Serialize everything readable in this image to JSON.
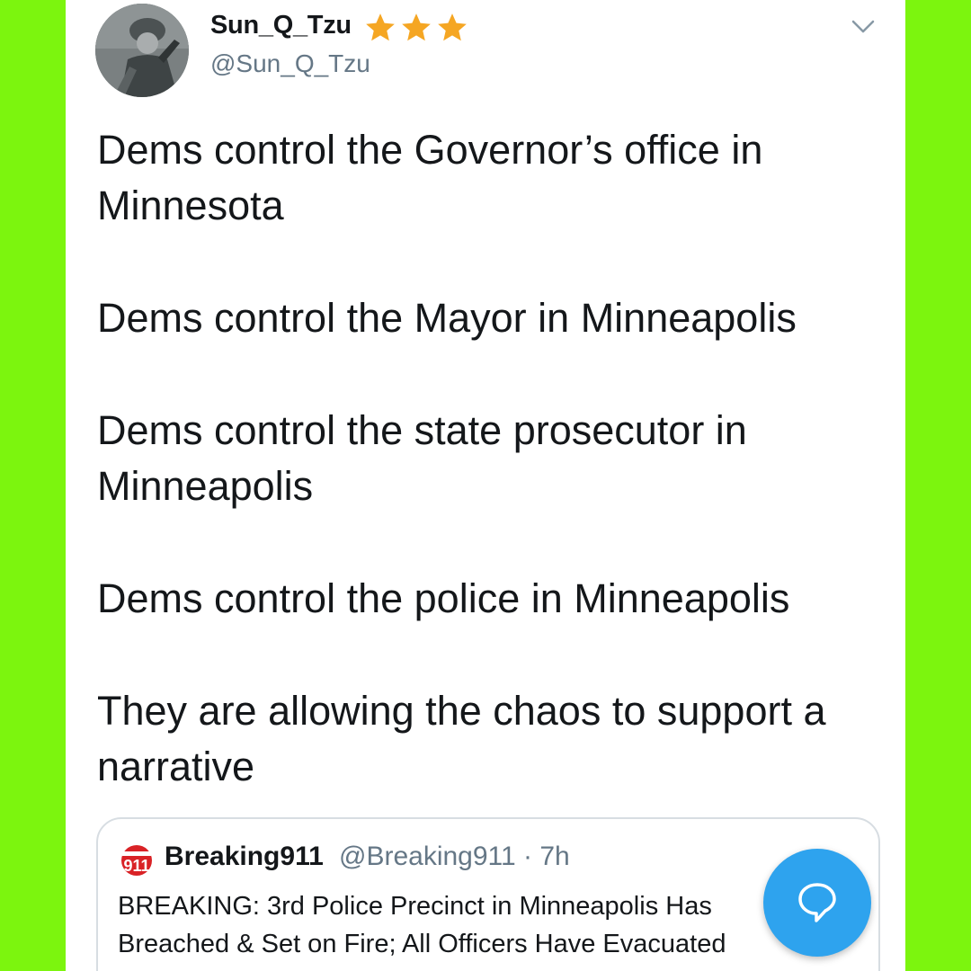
{
  "tweet": {
    "display_name": "Sun_Q_Tzu",
    "handle": "@Sun_Q_Tzu",
    "star_count": 3,
    "star_color": "#f5a623",
    "paragraphs": [
      "Dems control the Governor’s office in Minnesota",
      "Dems control the Mayor in Minneapolis",
      "Dems control the state prosecutor in Minneapolis",
      "Dems control the police in Minneapolis",
      "They are allowing the chaos to support a narrative"
    ]
  },
  "quoted": {
    "logo_text": "911",
    "logo_color": "#d92226",
    "display_name": "Breaking911",
    "handle_time": "@Breaking911 · 7h",
    "text": "BREAKING: 3rd Police Precinct in Minneapolis Has Breached & Set on Fire; All Officers Have Evacuated"
  },
  "colors": {
    "background": "#7cf50e",
    "accent": "#2ea3ee"
  }
}
